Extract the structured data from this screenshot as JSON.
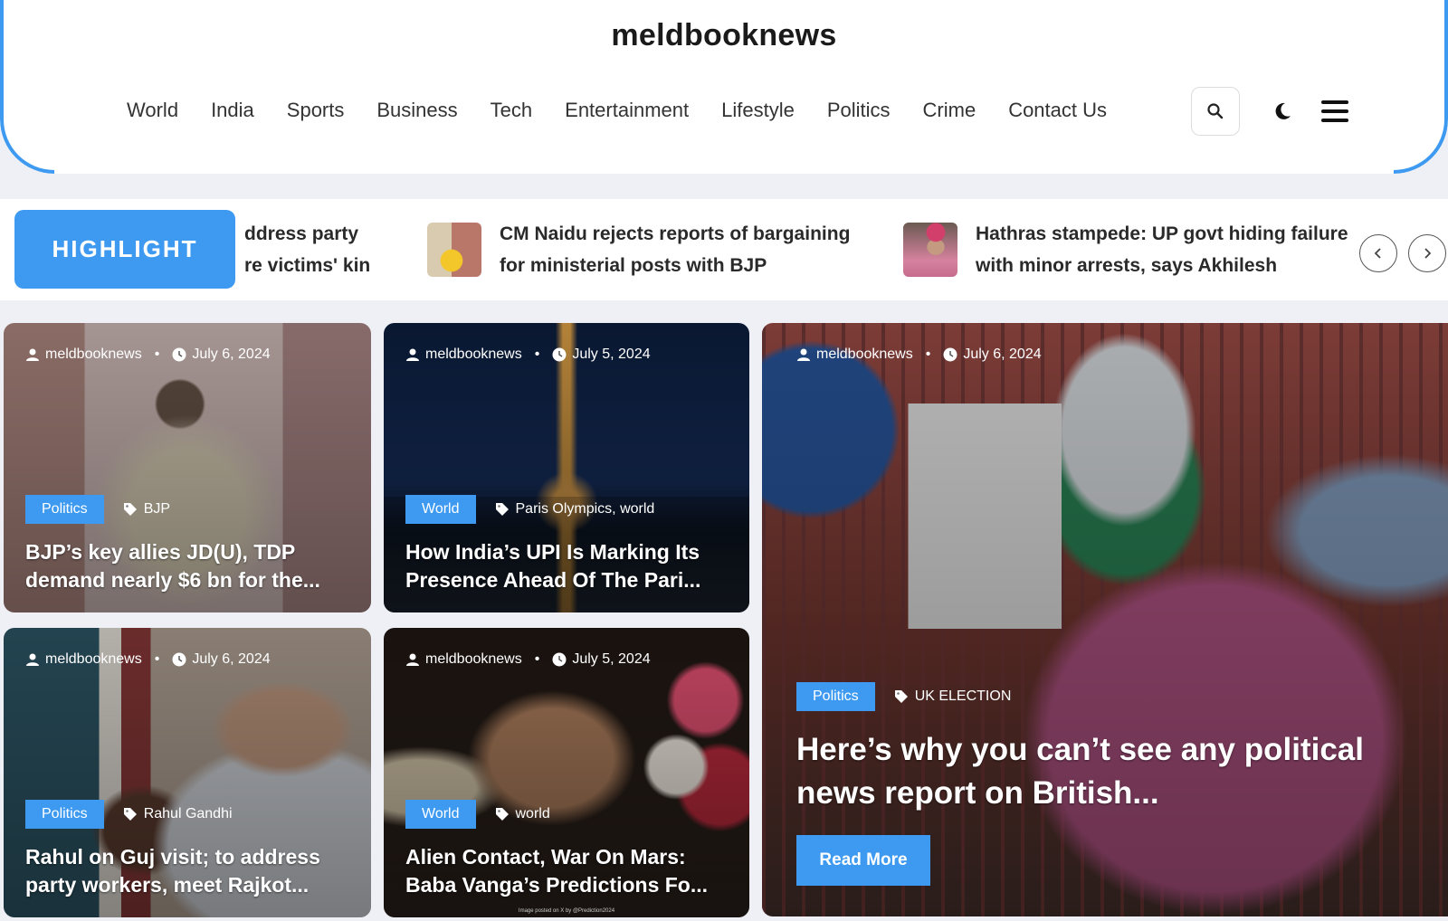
{
  "header": {
    "site_title": "meldbooknews",
    "nav": [
      "World",
      "India",
      "Sports",
      "Business",
      "Tech",
      "Entertainment",
      "Lifestyle",
      "Politics",
      "Crime",
      "Contact Us"
    ],
    "icons": {
      "search": "search-icon",
      "theme": "moon-icon",
      "menu": "hamburger-menu-icon"
    }
  },
  "ticker": {
    "badge": "HIGHLIGHT",
    "partial_line1": "ddress party",
    "partial_line2": "re victims' kin",
    "items": [
      {
        "title": "CM Naidu rejects reports of bargaining for ministerial posts with BJP"
      },
      {
        "title": "Hathras stampede: UP govt hiding failure with minor arrests, says Akhilesh"
      }
    ],
    "prev_icon": "chevron-left-icon",
    "next_icon": "chevron-right-icon"
  },
  "accent_color": "#3d9af0",
  "cards": [
    {
      "author": "meldbooknews",
      "date": "July 6, 2024",
      "category": "Politics",
      "tags": "BJP",
      "title": "BJP’s key allies JD(U), TDP demand nearly $6 bn for the..."
    },
    {
      "author": "meldbooknews",
      "date": "July 5, 2024",
      "category": "World",
      "tags": "Paris Olympics, world",
      "title": "How India’s UPI Is Marking Its Presence Ahead Of The Pari..."
    },
    {
      "author": "meldbooknews",
      "date": "July 6, 2024",
      "category": "Politics",
      "tags": "Rahul Gandhi",
      "title": "Rahul on Guj visit; to address party workers, meet Rajkot..."
    },
    {
      "author": "meldbooknews",
      "date": "July 5, 2024",
      "category": "World",
      "tags": "world",
      "title": "Alien Contact, War On Mars: Baba Vanga’s Predictions Fo...",
      "credit": "Image posted on X by @Prediction2024"
    }
  ],
  "featured": {
    "author": "meldbooknews",
    "date": "July 6, 2024",
    "category": "Politics",
    "tags": "UK ELECTION",
    "title": "Here’s why you can’t see any political news report on British...",
    "read_more": "Read More"
  }
}
